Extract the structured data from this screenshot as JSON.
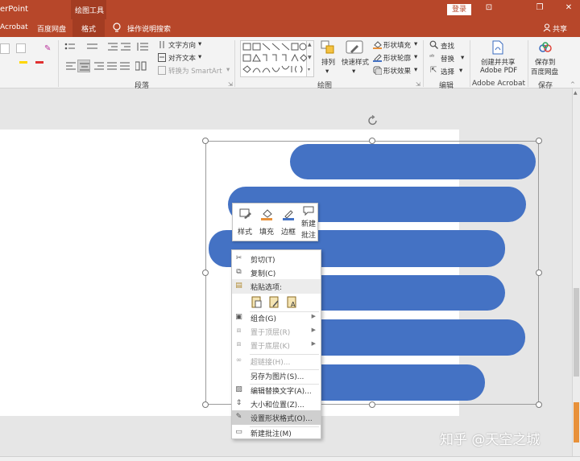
{
  "titlebar": {
    "app_title": "erPoint",
    "context_tab": "绘图工具",
    "login_label": "登录",
    "btn_ribbon_display": "⊡",
    "btn_restore": "❐",
    "btn_close": "✕"
  },
  "tabs": {
    "acrobat": "Acrobat",
    "baidu": "百度网盘",
    "format": "格式",
    "tell_me": "操作说明搜索",
    "share": "共享"
  },
  "ribbon": {
    "paragraph": {
      "group_label": "段落",
      "text_direction": "文字方向",
      "align_text": "对齐文本",
      "convert_smartart": "转换为 SmartArt"
    },
    "drawing": {
      "group_label": "绘图",
      "arrange": "排列",
      "quick_styles": "快速样式",
      "shape_fill": "形状填充",
      "shape_outline": "形状轮廓",
      "shape_effects": "形状效果"
    },
    "editing": {
      "group_label": "编辑",
      "find": "查找",
      "replace": "替换",
      "select": "选择"
    },
    "adobe": {
      "group_label": "Adobe Acrobat",
      "create_share_l1": "创建并共享",
      "create_share_l2": "Adobe PDF"
    },
    "save": {
      "group_label": "保存",
      "save_l1": "保存到",
      "save_l2": "百度网盘"
    }
  },
  "mini_toolbar": {
    "style": "样式",
    "fill": "填充",
    "border": "边框",
    "new_comment_l1": "新建",
    "new_comment_l2": "批注"
  },
  "context_menu": {
    "cut": "剪切(T)",
    "copy": "复制(C)",
    "paste_options": "粘贴选项:",
    "group": "组合(G)",
    "bring_front": "置于顶层(R)",
    "send_back": "置于底层(K)",
    "hyperlink": "超链接(H)...",
    "save_as_picture": "另存为图片(S)...",
    "edit_alt_text": "编辑替换文字(A)...",
    "size_position": "大小和位置(Z)...",
    "format_shape": "设置形状格式(O)...",
    "new_comment": "新建批注(M)"
  },
  "watermark": "知乎 @天空之城",
  "colors": {
    "accent": "#b7472a",
    "shape_fill": "#4472c4"
  }
}
